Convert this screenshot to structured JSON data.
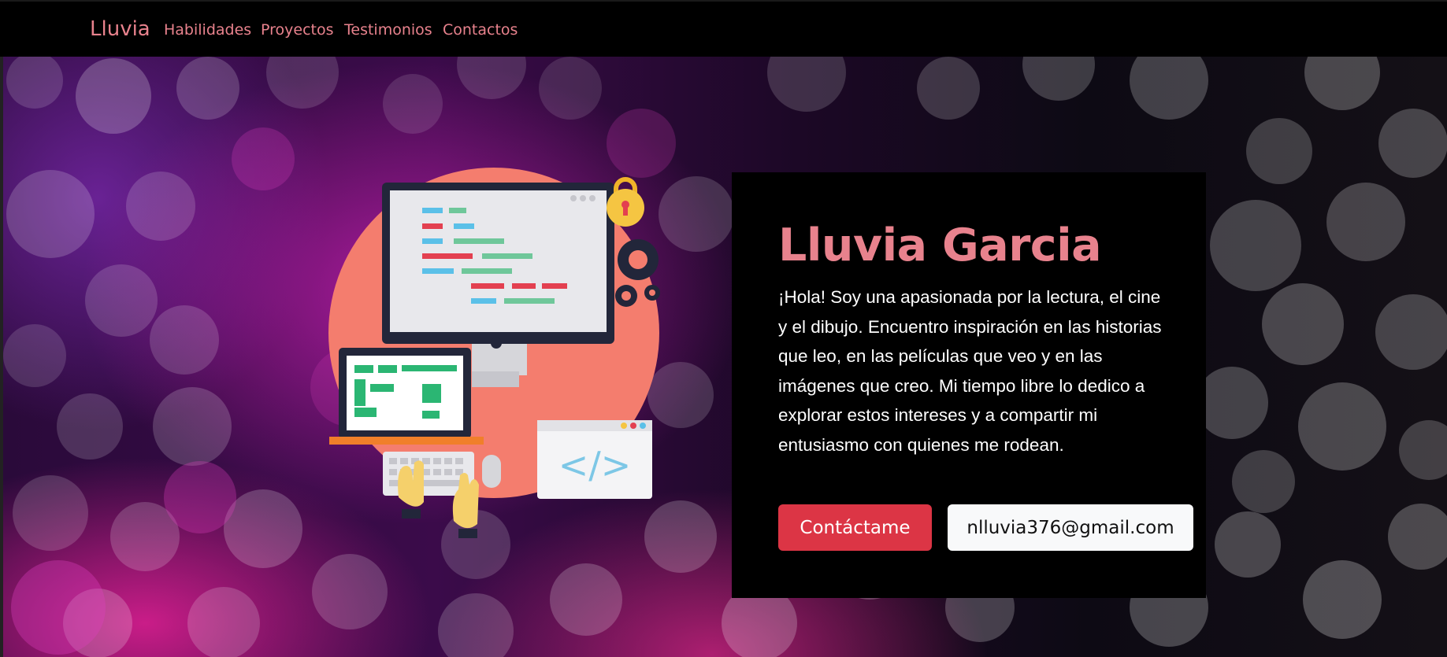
{
  "navbar": {
    "brand": "Lluvia",
    "links": [
      {
        "label": "Habilidades"
      },
      {
        "label": "Proyectos"
      },
      {
        "label": "Testimonios"
      },
      {
        "label": "Contactos"
      }
    ]
  },
  "hero": {
    "title": "Lluvia Garcia",
    "description": "¡Hola! Soy una apasionada por la lectura, el cine y el dibujo. Encuentro inspiración en las historias que leo, en las películas que veo y en las imágenes que creo. Mi tiempo libre lo dedico a explorar estos intereses y a compartir mi entusiasmo con quienes me rodean.",
    "contact_button": "Contáctame",
    "email_button": "nlluvia376@gmail.com",
    "illustration_code_label": "</>"
  },
  "colors": {
    "accent": "#e8828d",
    "danger": "#dc3545",
    "light": "#f8f9fa",
    "background": "#000000"
  }
}
